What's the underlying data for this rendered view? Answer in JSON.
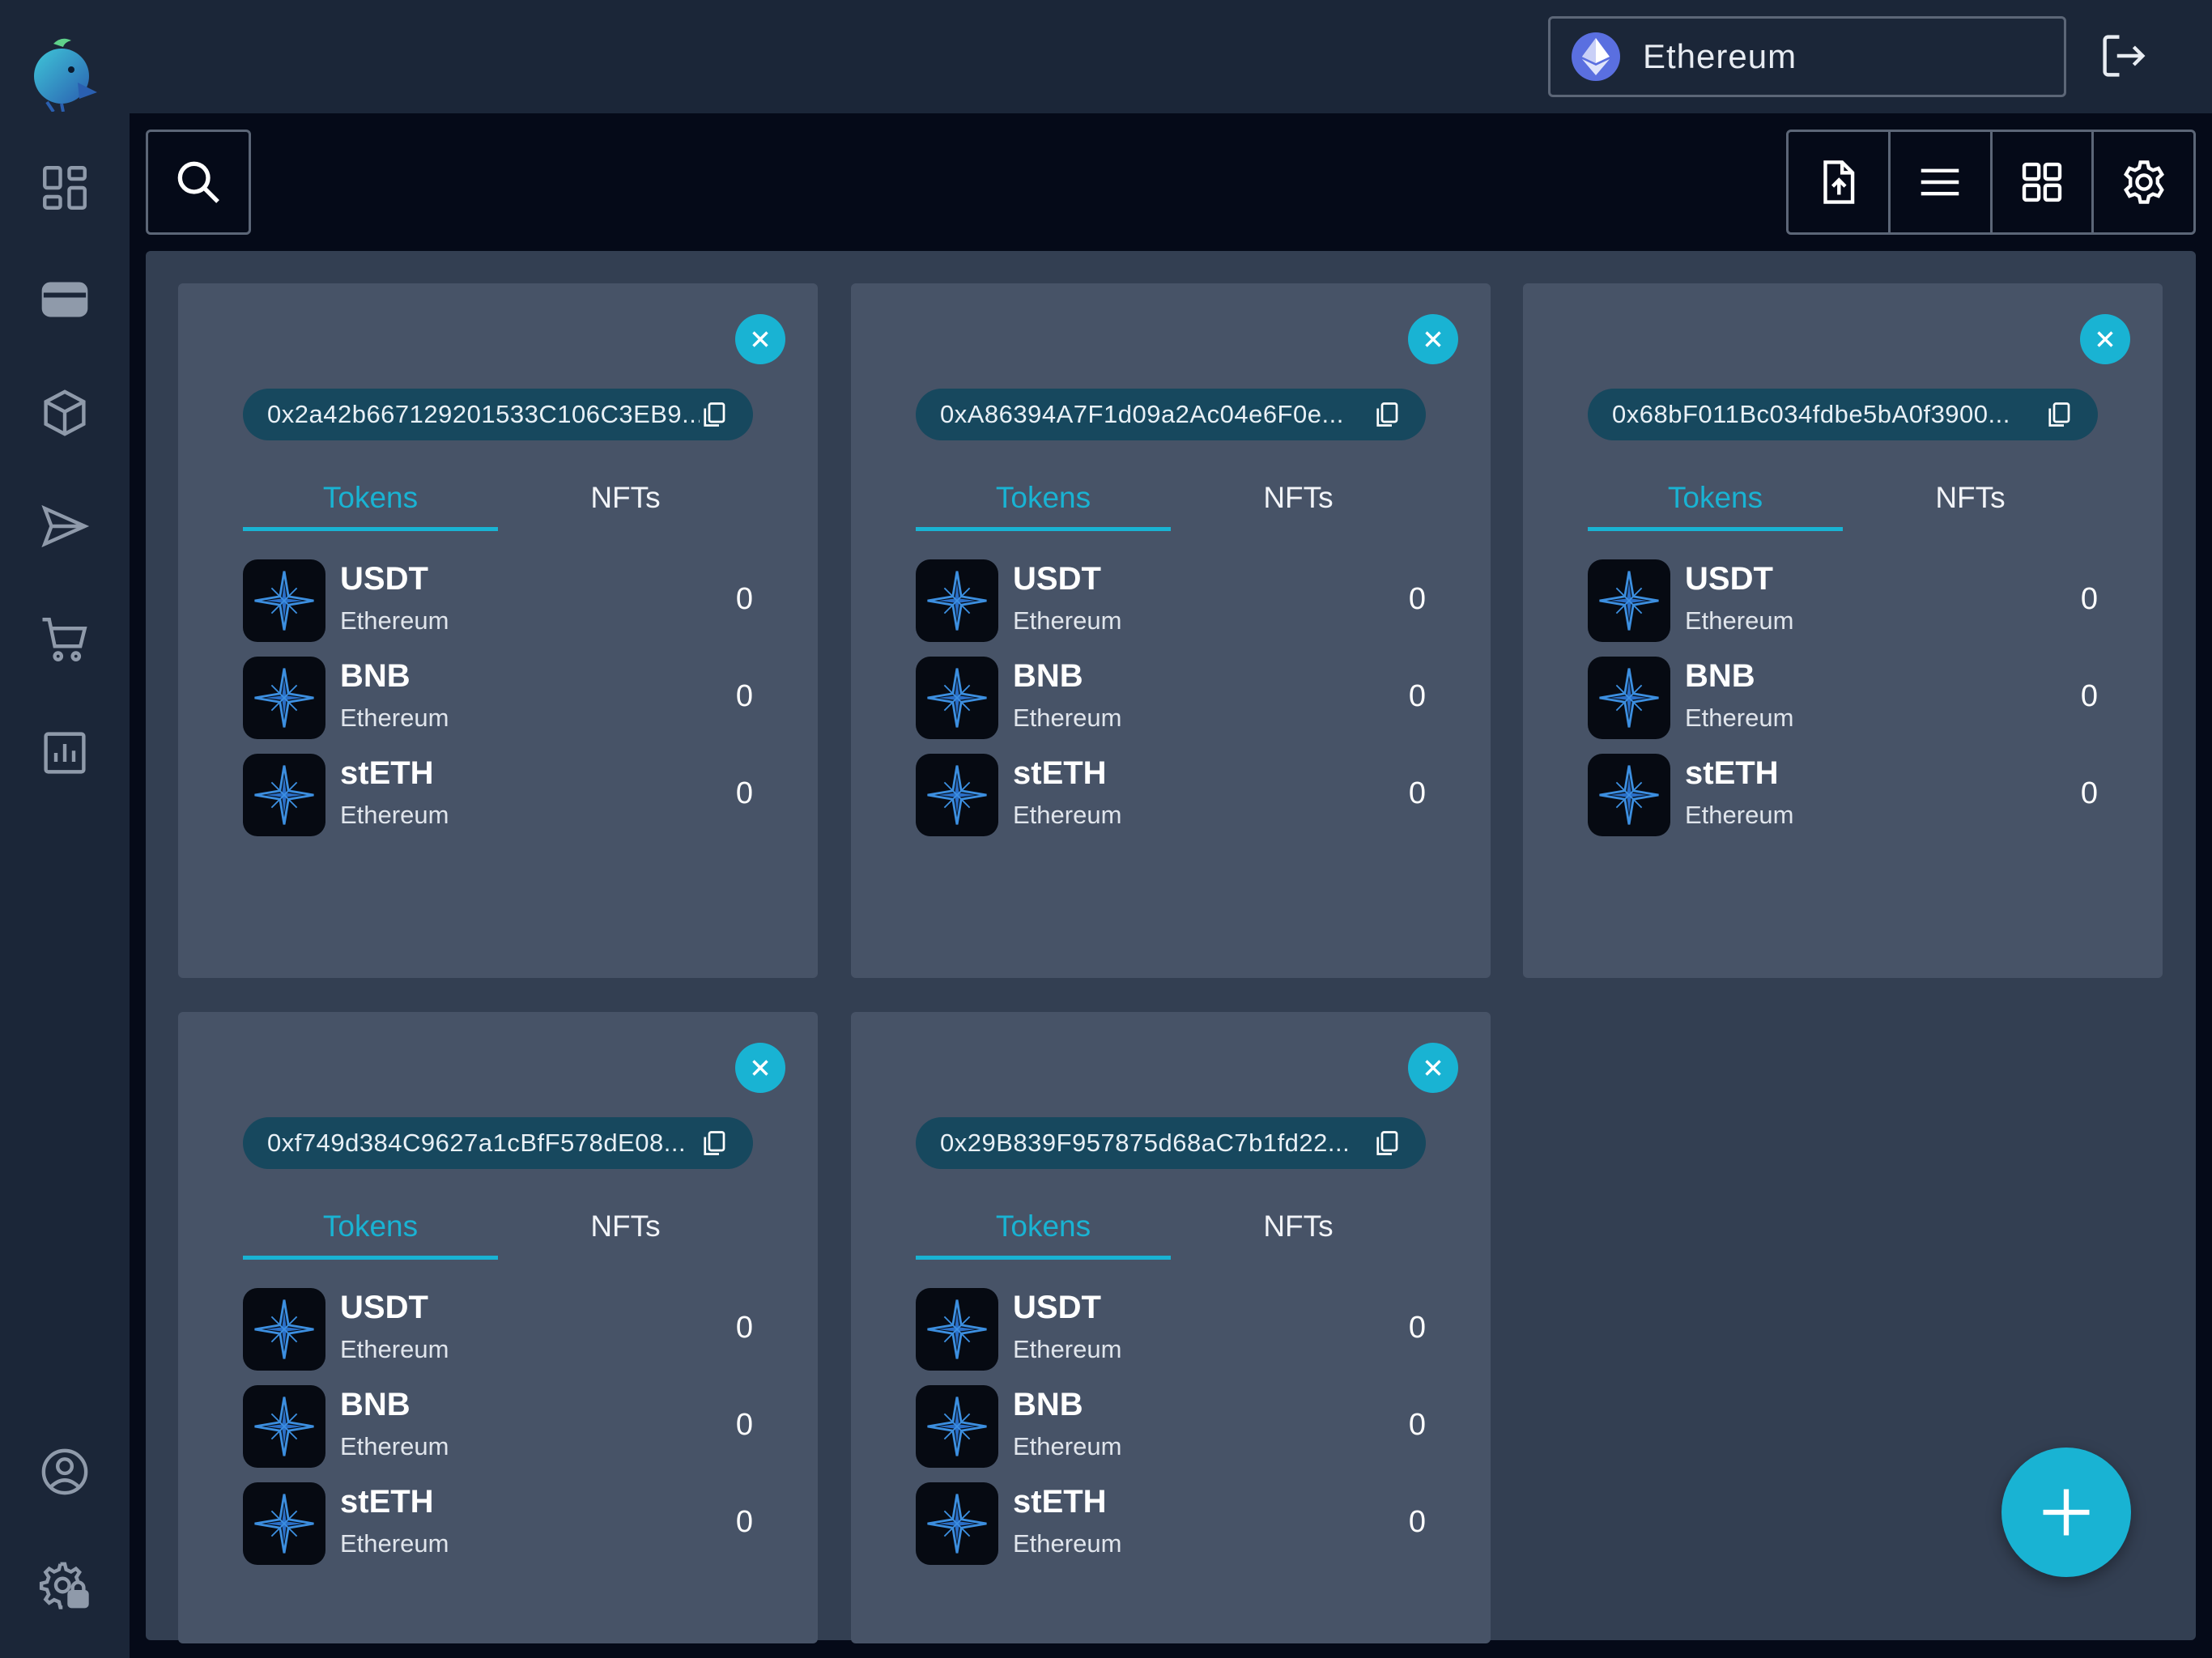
{
  "colors": {
    "accent": "#19b3d3",
    "sidebar": "#1b2638",
    "card": "#475367",
    "workspace": "#333f52"
  },
  "sidebar": {
    "items": [
      {
        "icon": "dashboard-icon"
      },
      {
        "icon": "wallet-icon"
      },
      {
        "icon": "cube-icon"
      },
      {
        "icon": "send-icon"
      },
      {
        "icon": "cart-icon"
      },
      {
        "icon": "chart-icon"
      }
    ],
    "bottom": [
      {
        "icon": "account-icon"
      },
      {
        "icon": "settings-lock-icon"
      }
    ]
  },
  "header": {
    "network": {
      "label": "Ethereum",
      "icon": "ethereum-icon"
    },
    "logout_icon": "logout-icon"
  },
  "toolbar": {
    "search_icon": "search-icon",
    "buttons": [
      "file-upload-icon",
      "list-view-icon",
      "grid-view-icon",
      "settings-icon"
    ]
  },
  "wallets": [
    {
      "address": "0x2a42b667129201533C106C3EB9...",
      "tabs": [
        "Tokens",
        "NFTs"
      ],
      "active_tab": "Tokens",
      "tokens": [
        {
          "symbol": "USDT",
          "network": "Ethereum",
          "balance": "0"
        },
        {
          "symbol": "BNB",
          "network": "Ethereum",
          "balance": "0"
        },
        {
          "symbol": "stETH",
          "network": "Ethereum",
          "balance": "0"
        }
      ]
    },
    {
      "address": "0xA86394A7F1d09a2Ac04e6F0e...",
      "tabs": [
        "Tokens",
        "NFTs"
      ],
      "active_tab": "Tokens",
      "tokens": [
        {
          "symbol": "USDT",
          "network": "Ethereum",
          "balance": "0"
        },
        {
          "symbol": "BNB",
          "network": "Ethereum",
          "balance": "0"
        },
        {
          "symbol": "stETH",
          "network": "Ethereum",
          "balance": "0"
        }
      ]
    },
    {
      "address": "0x68bF011Bc034fdbe5bA0f3900...",
      "tabs": [
        "Tokens",
        "NFTs"
      ],
      "active_tab": "Tokens",
      "tokens": [
        {
          "symbol": "USDT",
          "network": "Ethereum",
          "balance": "0"
        },
        {
          "symbol": "BNB",
          "network": "Ethereum",
          "balance": "0"
        },
        {
          "symbol": "stETH",
          "network": "Ethereum",
          "balance": "0"
        }
      ]
    },
    {
      "address": "0xf749d384C9627a1cBfF578dE08...",
      "tabs": [
        "Tokens",
        "NFTs"
      ],
      "active_tab": "Tokens",
      "tokens": [
        {
          "symbol": "USDT",
          "network": "Ethereum",
          "balance": "0"
        },
        {
          "symbol": "BNB",
          "network": "Ethereum",
          "balance": "0"
        },
        {
          "symbol": "stETH",
          "network": "Ethereum",
          "balance": "0"
        }
      ]
    },
    {
      "address": "0x29B839F957875d68aC7b1fd22...",
      "tabs": [
        "Tokens",
        "NFTs"
      ],
      "active_tab": "Tokens",
      "tokens": [
        {
          "symbol": "USDT",
          "network": "Ethereum",
          "balance": "0"
        },
        {
          "symbol": "BNB",
          "network": "Ethereum",
          "balance": "0"
        },
        {
          "symbol": "stETH",
          "network": "Ethereum",
          "balance": "0"
        }
      ]
    }
  ],
  "fab": {
    "icon": "plus-icon"
  }
}
